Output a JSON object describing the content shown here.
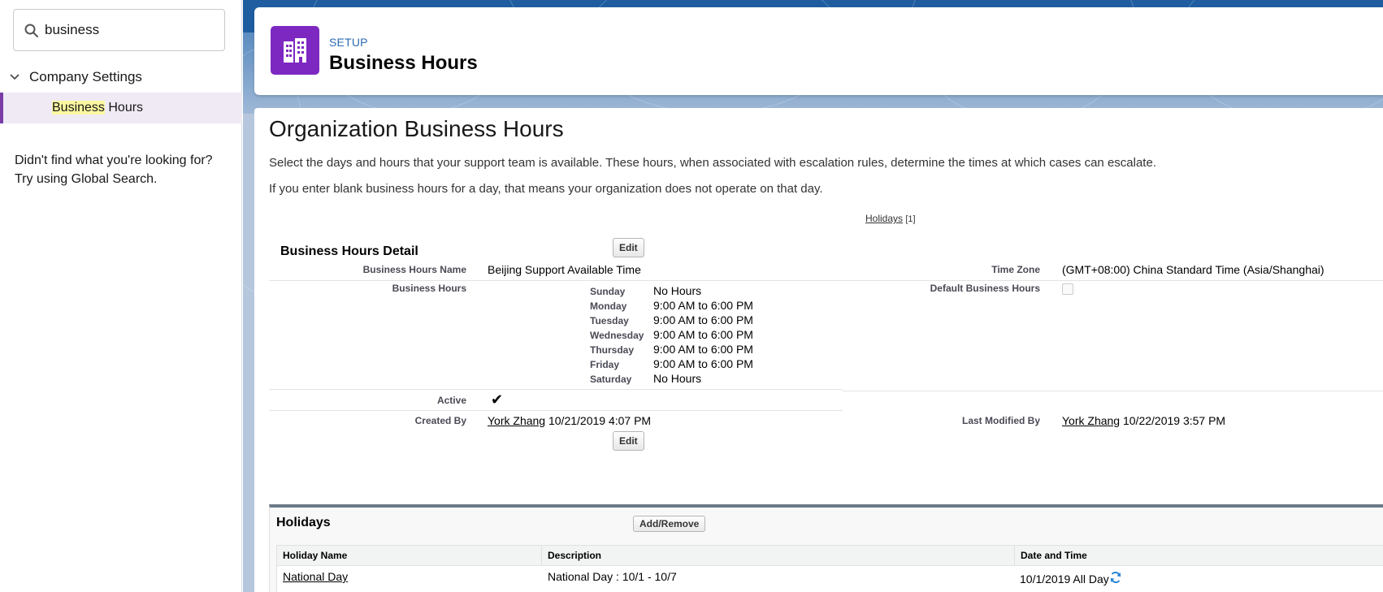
{
  "sidebar": {
    "search_value": "business",
    "tree": {
      "parent_label": "Company Settings",
      "child_label_highlight": "Business",
      "child_label_rest": " Hours"
    },
    "not_found_line1": "Didn't find what you're looking for?",
    "not_found_line2": "Try using Global Search."
  },
  "header": {
    "breadcrumb": "SETUP",
    "title": "Business Hours",
    "icon": "building-icon",
    "icon_color": "#7e28c2"
  },
  "content": {
    "title": "Organization Business Hours",
    "description1": "Select the days and hours that your support team is available. These hours, when associated with escalation rules, determine the times at which cases can escalate.",
    "description2": "If you enter blank business hours for a day, that means your organization does not operate on that day.",
    "holidays_link": {
      "label": "Holidays",
      "count": "[1]"
    }
  },
  "detail": {
    "section_title": "Business Hours Detail",
    "edit_label": "Edit",
    "fields": {
      "name_label": "Business Hours Name",
      "name_value": "Beijing Support Available Time",
      "time_zone_label": "Time Zone",
      "time_zone_value": "(GMT+08:00) China Standard Time (Asia/Shanghai)",
      "business_hours_label": "Business Hours",
      "default_label": "Default Business Hours",
      "active_label": "Active",
      "active_value": "✔",
      "created_by_label": "Created By",
      "created_by_user": "York Zhang",
      "created_by_date": "10/21/2019 4:07 PM",
      "last_modified_label": "Last Modified By",
      "last_modified_user": "York Zhang",
      "last_modified_date": "10/22/2019 3:57 PM"
    },
    "schedule": [
      {
        "day": "Sunday",
        "hours": "No Hours"
      },
      {
        "day": "Monday",
        "hours": "9:00 AM to 6:00 PM"
      },
      {
        "day": "Tuesday",
        "hours": "9:00 AM to 6:00 PM"
      },
      {
        "day": "Wednesday",
        "hours": "9:00 AM to 6:00 PM"
      },
      {
        "day": "Thursday",
        "hours": "9:00 AM to 6:00 PM"
      },
      {
        "day": "Friday",
        "hours": "9:00 AM to 6:00 PM"
      },
      {
        "day": "Saturday",
        "hours": "No Hours"
      }
    ]
  },
  "holidays": {
    "title": "Holidays",
    "add_remove_label": "Add/Remove",
    "columns": [
      "Holiday Name",
      "Description",
      "Date and Time"
    ],
    "rows": [
      {
        "name": "National Day",
        "description": "National Day : 10/1 - 10/7",
        "date": "10/1/2019 All Day",
        "recurring_icon": "refresh-icon"
      }
    ]
  },
  "colors": {
    "accent_purple": "#7e28c2",
    "selected_bg": "#f0eaf5",
    "link_blue": "#2c6bb1"
  }
}
